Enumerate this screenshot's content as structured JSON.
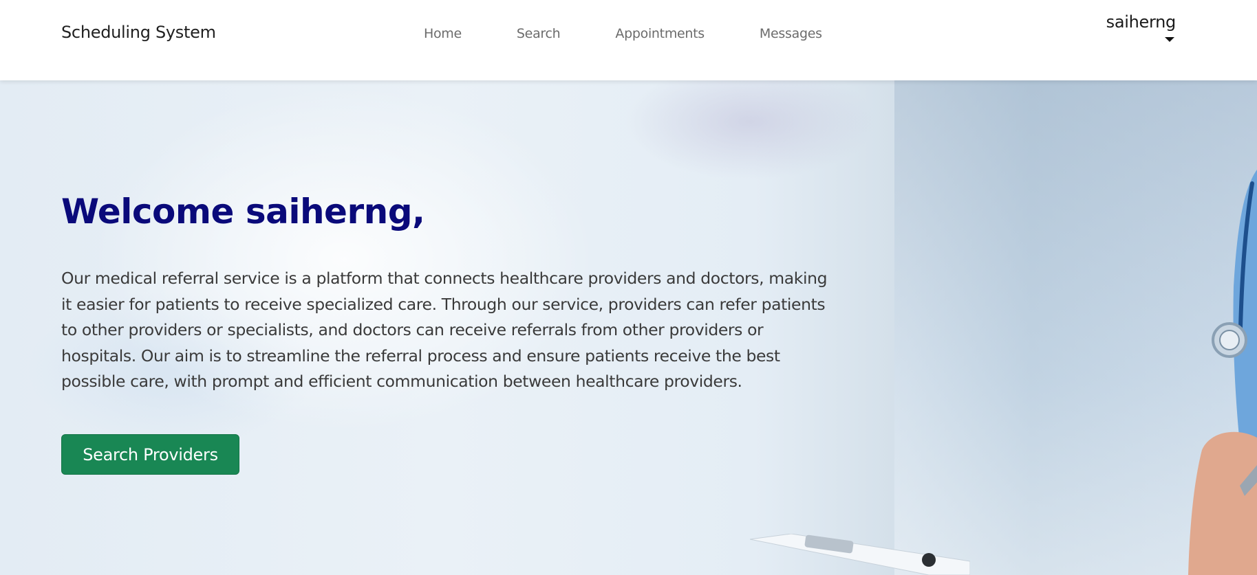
{
  "navbar": {
    "brand": "Scheduling System",
    "links": [
      {
        "label": "Home"
      },
      {
        "label": "Search"
      },
      {
        "label": "Appointments"
      },
      {
        "label": "Messages"
      }
    ],
    "user": {
      "name": "saiherng",
      "menu_icon": "caret-down-icon"
    }
  },
  "hero": {
    "title": "Welcome saiherng,",
    "description": "Our medical referral service is a platform that connects healthcare providers and doctors, making it easier for patients to receive specialized care. Through our service, providers can refer patients to other providers or specialists, and doctors can receive referrals from other providers or hospitals. Our aim is to streamline the referral process and ensure patients receive the best possible care, with prompt and efficient communication between healthcare providers.",
    "cta_label": "Search Providers",
    "title_color": "#0a0a7a",
    "cta_color": "#198754"
  }
}
